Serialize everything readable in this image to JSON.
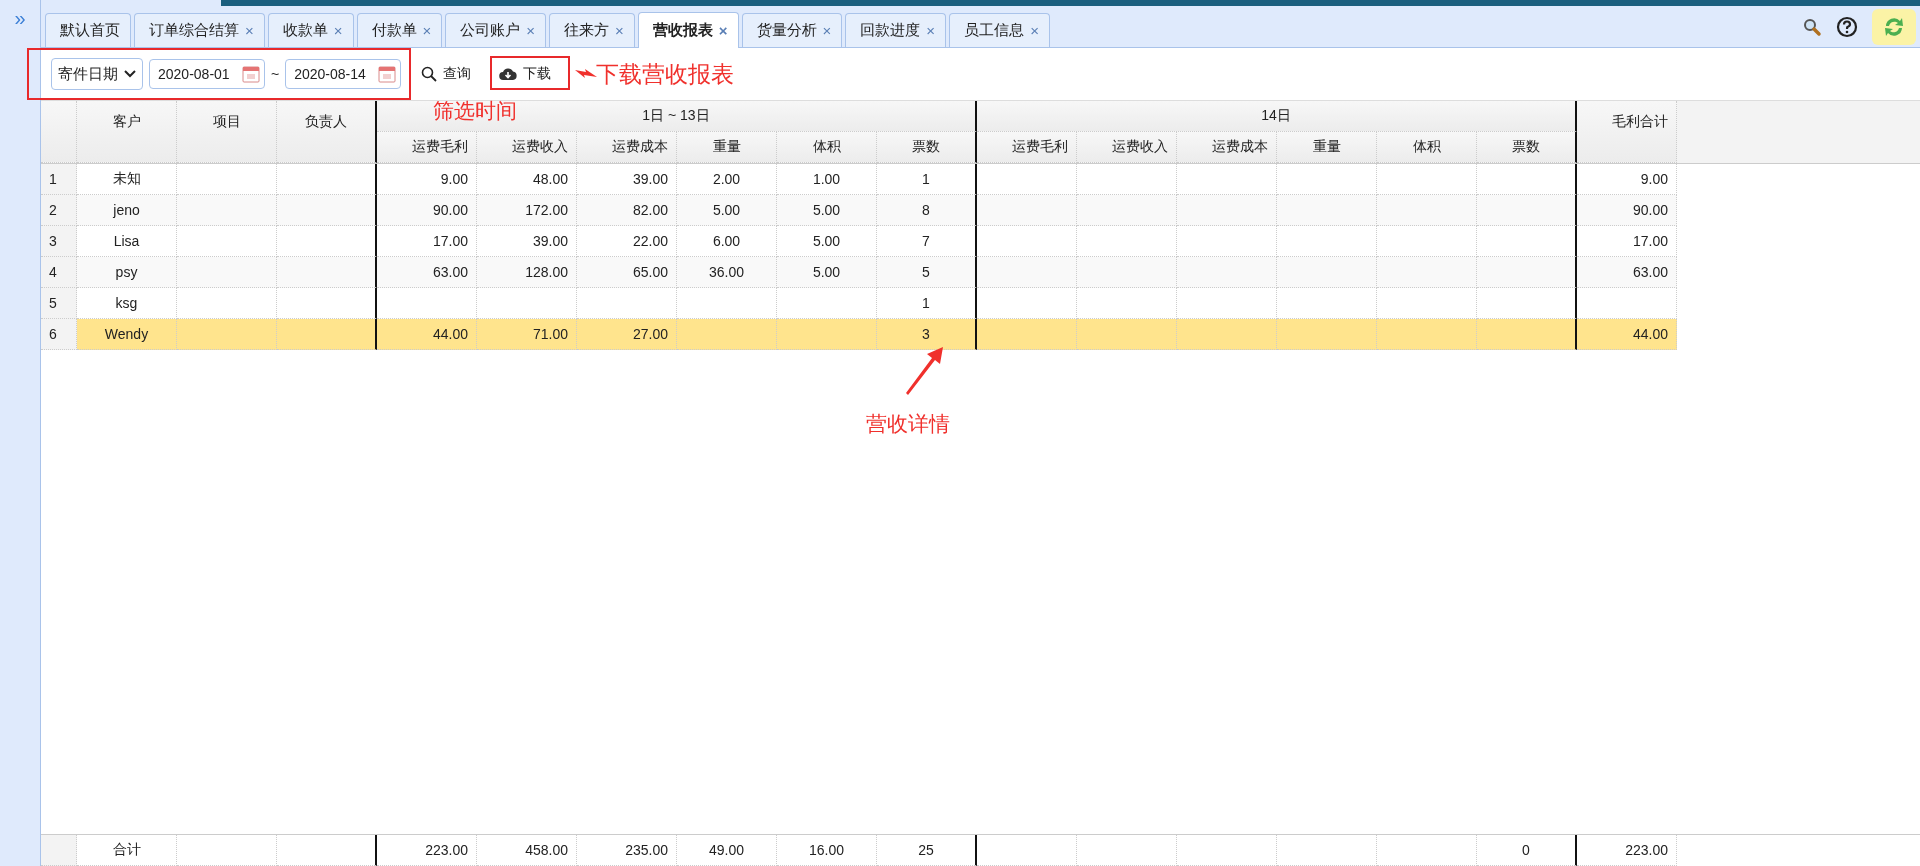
{
  "sidebar": {
    "toggle": "»"
  },
  "tabs": [
    {
      "label": "默认首页",
      "closable": false,
      "selected": false
    },
    {
      "label": "订单综合结算",
      "closable": true,
      "selected": false
    },
    {
      "label": "收款单",
      "closable": true,
      "selected": false
    },
    {
      "label": "付款单",
      "closable": true,
      "selected": false
    },
    {
      "label": "公司账户",
      "closable": true,
      "selected": false
    },
    {
      "label": "往来方",
      "closable": true,
      "selected": false
    },
    {
      "label": "营收报表",
      "closable": true,
      "selected": true
    },
    {
      "label": "货量分析",
      "closable": true,
      "selected": false
    },
    {
      "label": "回款进度",
      "closable": true,
      "selected": false
    },
    {
      "label": "员工信息",
      "closable": true,
      "selected": false
    }
  ],
  "tab_close": "×",
  "toolbar": {
    "date_type": "寄件日期",
    "start_date": "2020-08-01",
    "separator": "~",
    "end_date": "2020-08-14",
    "query": "查询",
    "download": "下载"
  },
  "table": {
    "left_columns": [
      "客户",
      "项目",
      "负责人"
    ],
    "groups": [
      {
        "title": "1日 ~ 13日",
        "columns": [
          "运费毛利",
          "运费收入",
          "运费成本",
          "重量",
          "体积",
          "票数"
        ]
      },
      {
        "title": "14日",
        "columns": [
          "运费毛利",
          "运费收入",
          "运费成本",
          "重量",
          "体积",
          "票数"
        ]
      }
    ],
    "total_column": "毛利合计",
    "rows": [
      {
        "index": "1",
        "selected": false,
        "cells": [
          "未知",
          null,
          null,
          "9.00",
          "48.00",
          "39.00",
          "2.00",
          "1.00",
          "1",
          null,
          null,
          null,
          null,
          null,
          null,
          "9.00"
        ]
      },
      {
        "index": "2",
        "selected": false,
        "cells": [
          "jeno",
          null,
          null,
          "90.00",
          "172.00",
          "82.00",
          "5.00",
          "5.00",
          "8",
          null,
          null,
          null,
          null,
          null,
          null,
          "90.00"
        ]
      },
      {
        "index": "3",
        "selected": false,
        "cells": [
          "Lisa",
          null,
          null,
          "17.00",
          "39.00",
          "22.00",
          "6.00",
          "5.00",
          "7",
          null,
          null,
          null,
          null,
          null,
          null,
          "17.00"
        ]
      },
      {
        "index": "4",
        "selected": false,
        "cells": [
          "psy",
          null,
          null,
          "63.00",
          "128.00",
          "65.00",
          "36.00",
          "5.00",
          "5",
          null,
          null,
          null,
          null,
          null,
          null,
          "63.00"
        ]
      },
      {
        "index": "5",
        "selected": false,
        "cells": [
          "ksg",
          null,
          null,
          null,
          null,
          null,
          null,
          null,
          "1",
          null,
          null,
          null,
          null,
          null,
          null,
          null
        ]
      },
      {
        "index": "6",
        "selected": true,
        "cells": [
          "Wendy",
          null,
          null,
          "44.00",
          "71.00",
          "27.00",
          null,
          null,
          "3",
          null,
          null,
          null,
          null,
          null,
          null,
          "44.00"
        ]
      }
    ],
    "footer": {
      "label": "合计",
      "groups": [
        {
          "freight_profit": "223.00",
          "freight_income": "458.00",
          "freight_cost": "235.00",
          "weight": "49.00",
          "volume": "16.00",
          "tickets": "25"
        },
        {
          "tickets": "0"
        }
      ],
      "total": "223.00"
    }
  },
  "annotations": {
    "download": "下载营收报表",
    "filter": "筛选时间",
    "detail": "营收详情"
  }
}
